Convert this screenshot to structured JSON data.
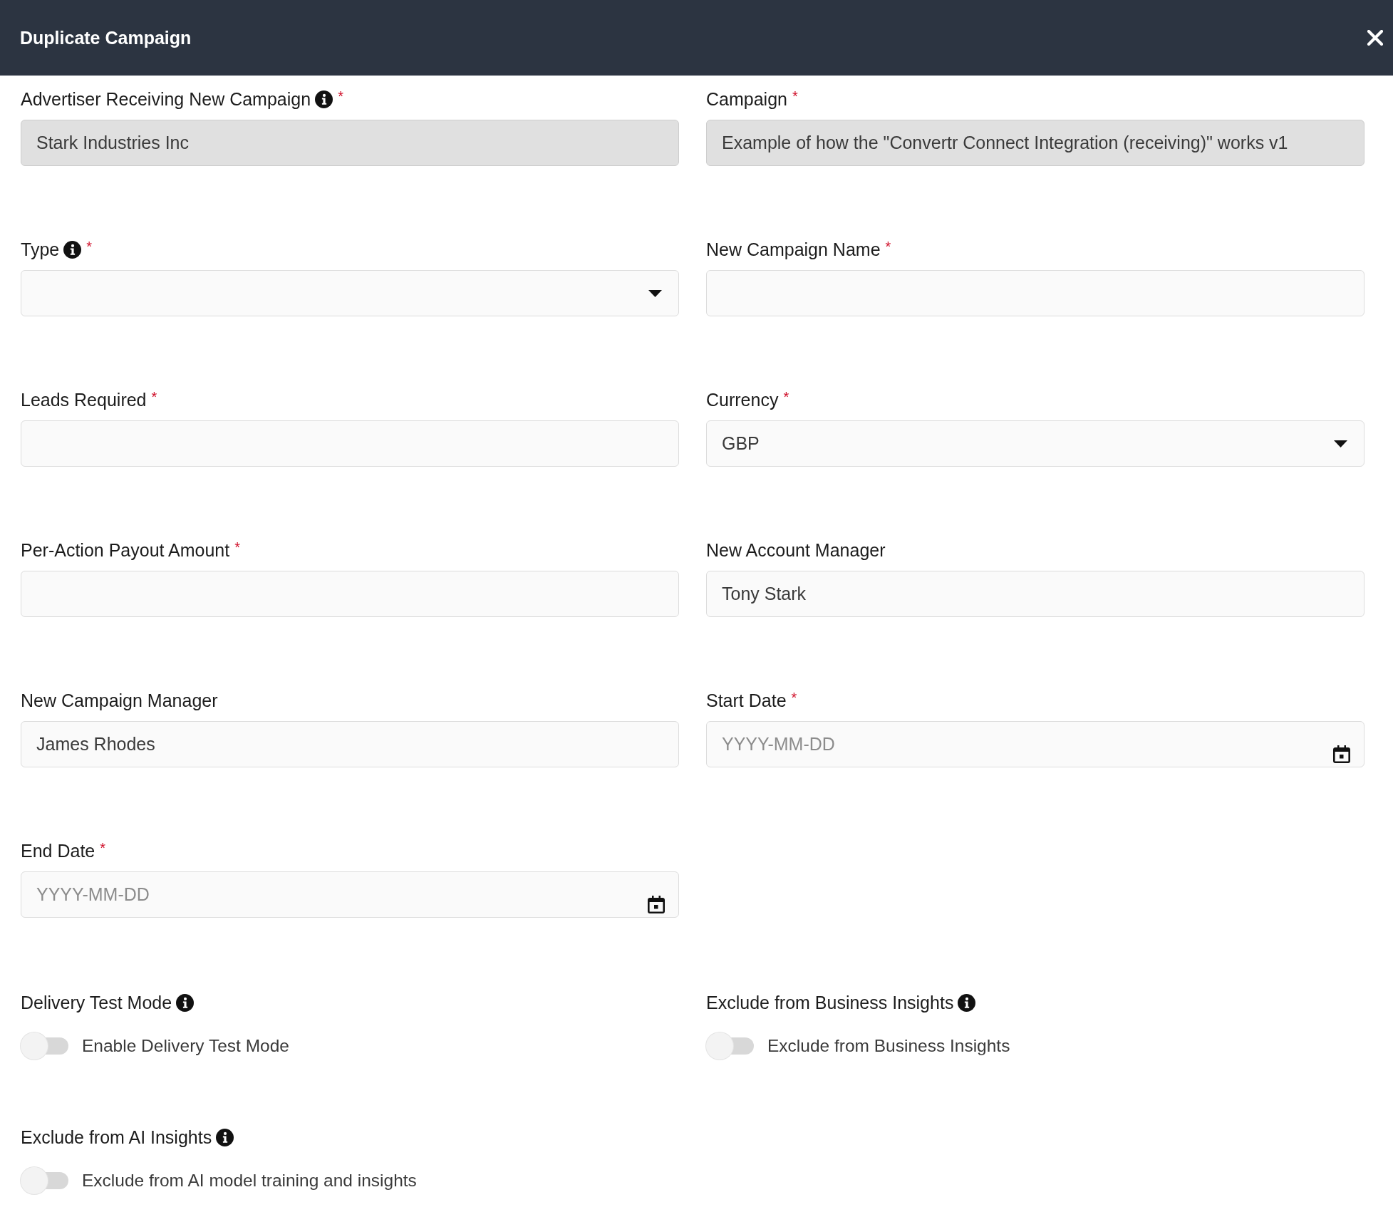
{
  "dialog": {
    "title": "Duplicate Campaign"
  },
  "fields": [
    {
      "label": "Advertiser Receiving New Campaign",
      "info": true,
      "required_mark": "*",
      "kind": "text",
      "disabled": true,
      "value": "Stark Industries Inc"
    },
    {
      "label": "Campaign",
      "info": false,
      "required_mark": "*",
      "kind": "text",
      "disabled": true,
      "value": "Example of how the \"Convertr Connect Integration (receiving)\" works v1"
    },
    {
      "label": "Type",
      "info": true,
      "required_mark": "*",
      "kind": "select",
      "disabled": false
    },
    {
      "label": "New Campaign Name",
      "info": false,
      "required_mark": "*",
      "kind": "text",
      "disabled": false
    },
    {
      "label": "Leads Required",
      "info": false,
      "required_mark": "*",
      "kind": "text",
      "disabled": false
    },
    {
      "label": "Currency",
      "info": false,
      "required_mark": "*",
      "kind": "select",
      "disabled": false,
      "value": "GBP"
    },
    {
      "label": "Per-Action Payout Amount",
      "info": false,
      "required_mark": "*",
      "kind": "text",
      "disabled": false
    },
    {
      "label": "New Account Manager",
      "info": false,
      "kind": "text",
      "disabled": false,
      "value": "Tony Stark"
    },
    {
      "label": "New Campaign Manager",
      "info": false,
      "kind": "text",
      "disabled": false,
      "value": "James Rhodes"
    },
    {
      "label": "Start Date",
      "info": false,
      "required_mark": "*",
      "kind": "date",
      "disabled": false,
      "placeholder": "YYYY-MM-DD"
    },
    {
      "label": "End Date",
      "info": false,
      "required_mark": "*",
      "kind": "date",
      "disabled": false,
      "placeholder": "YYYY-MM-DD"
    }
  ],
  "switches": [
    {
      "label": "Delivery Test Mode",
      "info": true,
      "text": "Enable Delivery Test Mode",
      "on": false
    },
    {
      "label": "Exclude from Business Insights",
      "info": true,
      "text": "Exclude from Business Insights",
      "on": false
    },
    {
      "label": "Exclude from AI Insights",
      "info": true,
      "text": "Exclude from AI model training and insights",
      "on": false
    }
  ]
}
